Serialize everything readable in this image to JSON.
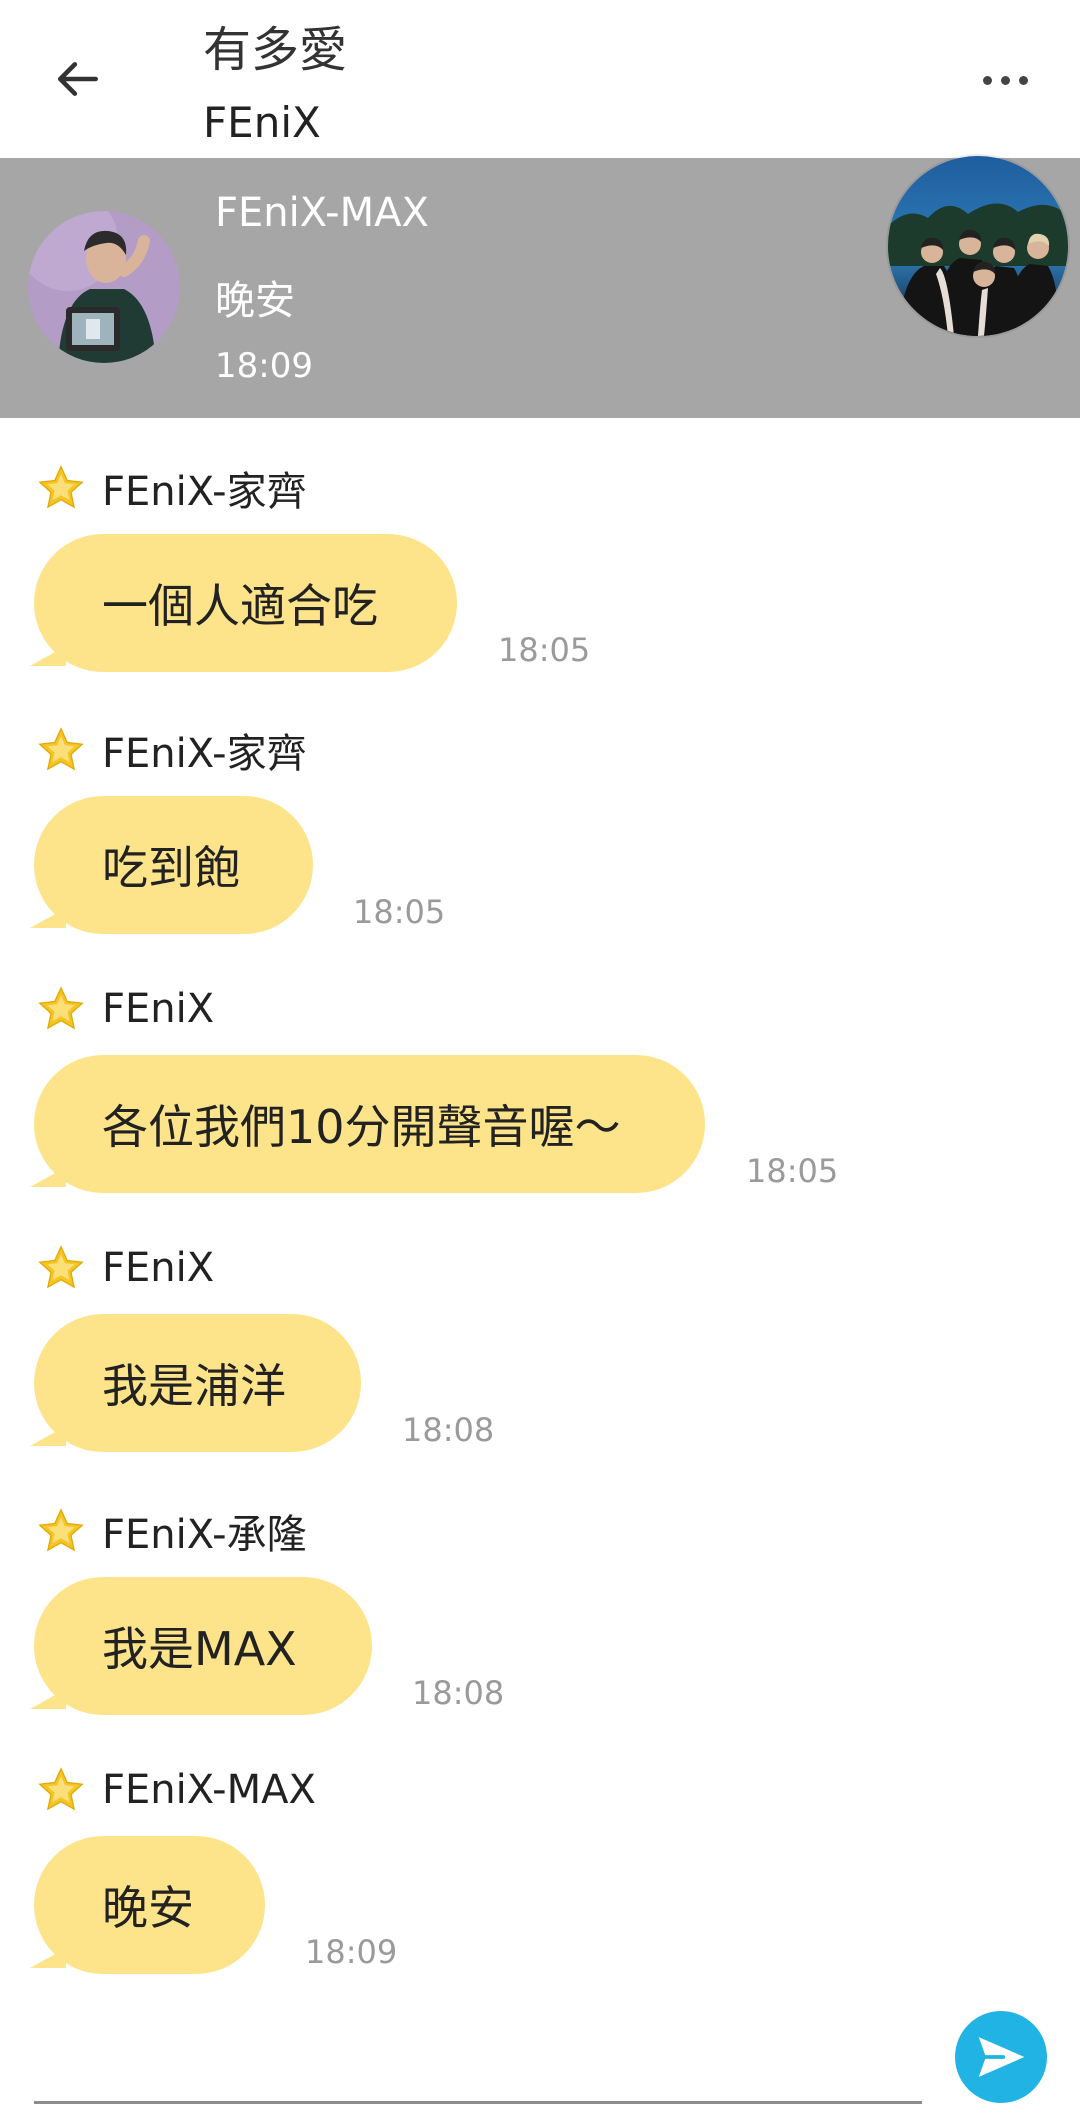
{
  "header": {
    "title": "有多愛",
    "subtitle": "FEniX"
  },
  "banner": {
    "name": "FEniX-MAX",
    "text": "晚安",
    "time": "18:09"
  },
  "messages": [
    {
      "sender": "FEniX-家齊",
      "text": "一個人適合吃",
      "time": "18:05"
    },
    {
      "sender": "FEniX-家齊",
      "text": "吃到飽",
      "time": "18:05"
    },
    {
      "sender": "FEniX",
      "text": "各位我們10分開聲音喔～",
      "time": "18:05"
    },
    {
      "sender": "FEniX",
      "text": "我是浦洋",
      "time": "18:08"
    },
    {
      "sender": "FEniX-承隆",
      "text": "我是MAX",
      "time": "18:08"
    },
    {
      "sender": "FEniX-MAX",
      "text": "晚安",
      "time": "18:09"
    }
  ],
  "input": {
    "value": "",
    "placeholder": ""
  },
  "colors": {
    "bubble": "#fde48a",
    "banner": "#a6a6a6",
    "send_button": "#22b3e5",
    "star": "#f5c425"
  },
  "icons": {
    "back": "arrow-left-icon",
    "more": "more-dots-icon",
    "star": "star-icon",
    "send": "send-icon"
  }
}
